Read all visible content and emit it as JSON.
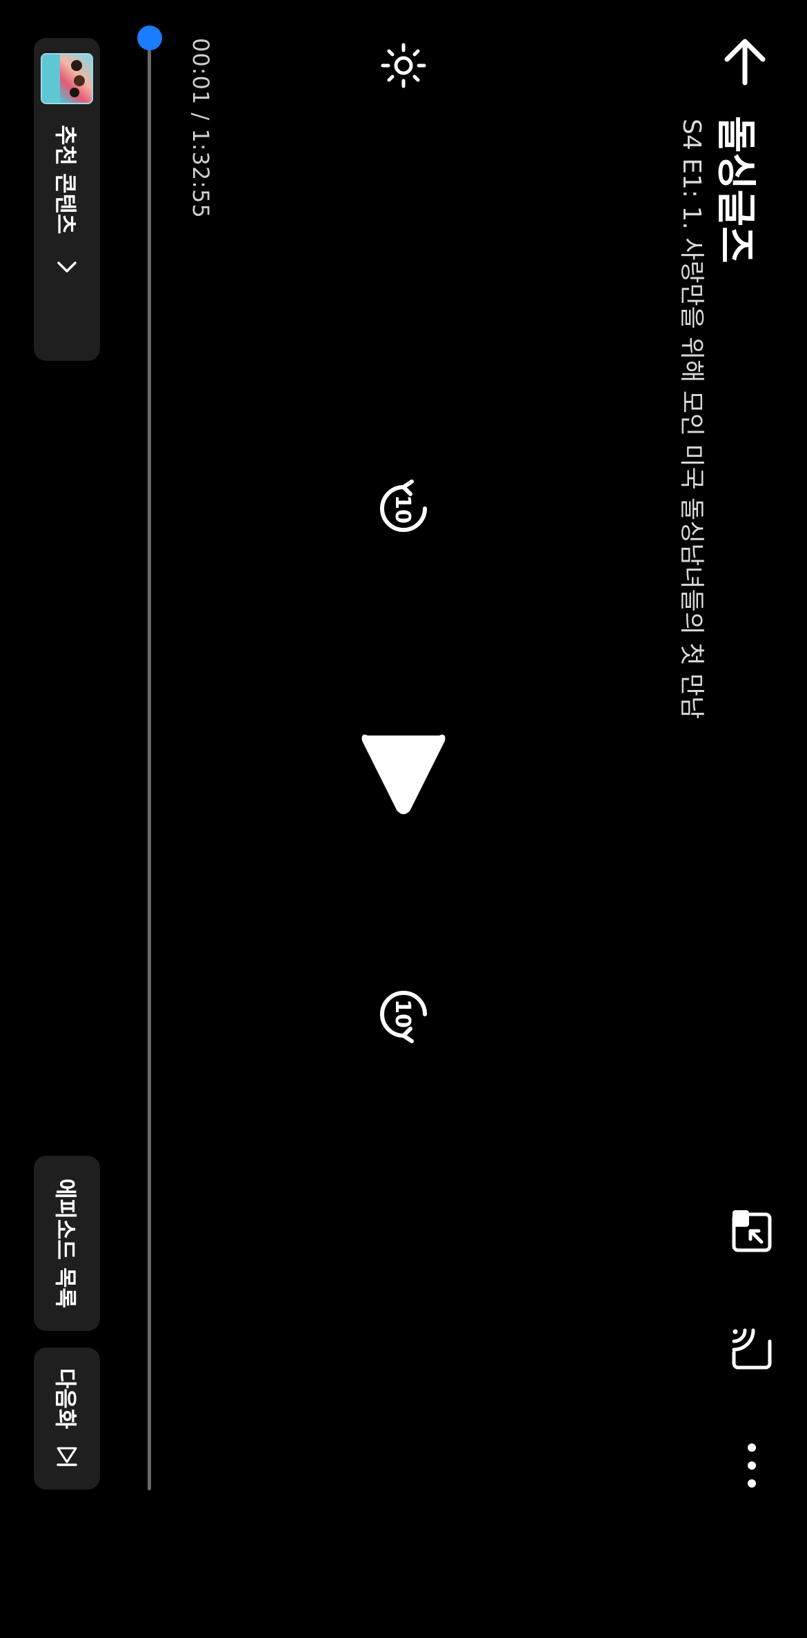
{
  "header": {
    "title": "돌싱글즈",
    "subtitle": "S4 E1: 1. 사랑만을 위해 모인 미국 돌싱남녀들의 첫 만남"
  },
  "player": {
    "current_time": "00:01",
    "total_time": "1:32:55",
    "time_display": "00:01 / 1:32:55",
    "progress": 0.0,
    "rewind_seconds": "10",
    "forward_seconds": "10"
  },
  "buttons": {
    "recommend_label": "추천 콘텐츠",
    "episodes_label": "에피소드 목록",
    "next_label": "다음화"
  },
  "colors": {
    "accent": "#1a7cff",
    "background": "#000000",
    "pill": "#1f1f1f"
  },
  "icons": {
    "back": "arrow-left-icon",
    "pip": "picture-in-picture-icon",
    "cast": "cast-icon",
    "more": "more-horizontal-icon",
    "brightness": "brightness-icon",
    "rewind": "rewind-10-icon",
    "play": "play-icon",
    "forward": "forward-10-icon",
    "recommend_chevron": "chevron-right-icon",
    "next": "skip-next-icon"
  }
}
